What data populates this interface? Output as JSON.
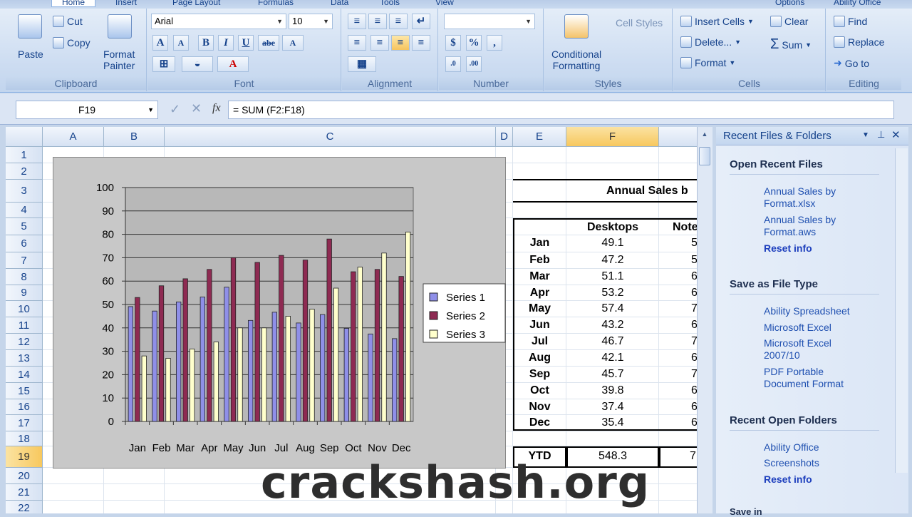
{
  "ribbon": {
    "tabs": [
      "Home",
      "Insert",
      "Page Layout",
      "Formulas",
      "Data",
      "Tools",
      "View"
    ],
    "right_tabs": [
      "Options",
      "Ability Office"
    ],
    "groups": {
      "clipboard": {
        "label": "Clipboard",
        "paste": "Paste",
        "cut": "Cut",
        "copy": "Copy",
        "format_painter_1": "Format",
        "format_painter_2": "Painter"
      },
      "font": {
        "label": "Font",
        "font_name": "Arial",
        "font_size": "10",
        "bold": "B",
        "italic": "I",
        "underline": "U",
        "strike": "abe"
      },
      "alignment": {
        "label": "Alignment"
      },
      "number": {
        "label": "Number",
        "format": "",
        "percent": "%",
        "comma": ","
      },
      "styles": {
        "label": "Styles",
        "conditional_1": "Conditional",
        "conditional_2": "Formatting",
        "cell_styles": "Cell Styles"
      },
      "cells": {
        "label": "Cells",
        "insert": "Insert Cells",
        "delete": "Delete...",
        "format": "Format"
      },
      "editing": {
        "label": "Editing",
        "clear": "Clear",
        "sum": "Sum",
        "find": "Find",
        "replace": "Replace",
        "goto": "Go to"
      }
    }
  },
  "formula_bar": {
    "name_box": "F19",
    "fx": "fx",
    "formula": "= SUM (F2:F18)"
  },
  "grid": {
    "columns": [
      "A",
      "B",
      "C",
      "D",
      "E",
      "F"
    ],
    "rows": [
      "1",
      "2",
      "3",
      "4",
      "5",
      "6",
      "7",
      "8",
      "9",
      "10",
      "11",
      "12",
      "13",
      "14",
      "15",
      "16",
      "17",
      "18",
      "19",
      "20",
      "21",
      "22"
    ],
    "selected_cell": "F19"
  },
  "table": {
    "title": "Annual Sales b",
    "col_desktops": "Desktops",
    "col_notebooks": "Note",
    "months": [
      "Jan",
      "Feb",
      "Mar",
      "Apr",
      "May",
      "Jun",
      "Jul",
      "Aug",
      "Sep",
      "Oct",
      "Nov",
      "Dec"
    ],
    "desktops": [
      "49.1",
      "47.2",
      "51.1",
      "53.2",
      "57.4",
      "43.2",
      "46.7",
      "42.1",
      "45.7",
      "39.8",
      "37.4",
      "35.4"
    ],
    "notebooks_partial": [
      "5",
      "5",
      "6",
      "6",
      "7",
      "6",
      "7",
      "6",
      "7",
      "6",
      "6",
      "6"
    ],
    "ytd_label": "YTD",
    "ytd_desktops": "548.3",
    "ytd_notebooks_partial": "7"
  },
  "chart_data": {
    "type": "bar",
    "categories": [
      "Jan",
      "Feb",
      "Mar",
      "Apr",
      "May",
      "Jun",
      "Jul",
      "Aug",
      "Sep",
      "Oct",
      "Nov",
      "Dec"
    ],
    "series": [
      {
        "name": "Series 1",
        "color": "#8f8fe8",
        "values": [
          49.1,
          47.2,
          51.1,
          53.2,
          57.4,
          43.2,
          46.7,
          42.1,
          45.7,
          39.8,
          37.4,
          35.4
        ]
      },
      {
        "name": "Series 2",
        "color": "#8e2a52",
        "values": [
          53,
          58,
          61,
          65,
          70,
          68,
          71,
          69,
          78,
          64,
          65,
          62
        ]
      },
      {
        "name": "Series 3",
        "color": "#ffffcc",
        "values": [
          28,
          27,
          31,
          34,
          40,
          40,
          45,
          48,
          57,
          66,
          72,
          81
        ]
      }
    ],
    "yticks": [
      "0",
      "10",
      "20",
      "30",
      "40",
      "50",
      "60",
      "70",
      "80",
      "90",
      "100"
    ],
    "ylim": [
      0,
      100
    ],
    "legend_position": "right"
  },
  "task_pane": {
    "title": "Recent Files & Folders",
    "sections": [
      {
        "heading": "Open Recent Files",
        "links": [
          "Annual Sales by Format.xlsx",
          "Annual Sales by Format.aws"
        ],
        "reset": "Reset info"
      },
      {
        "heading": "Save as File Type",
        "links": [
          "Ability Spreadsheet",
          "Microsoft Excel",
          "Microsoft Excel 2007/10",
          "PDF Portable Document Format"
        ]
      },
      {
        "heading": "Recent Open Folders",
        "links": [
          "Ability Office",
          "Screenshots"
        ],
        "reset": "Reset info"
      }
    ],
    "footer_partial": "Save in"
  },
  "watermark": "crackshash.org"
}
